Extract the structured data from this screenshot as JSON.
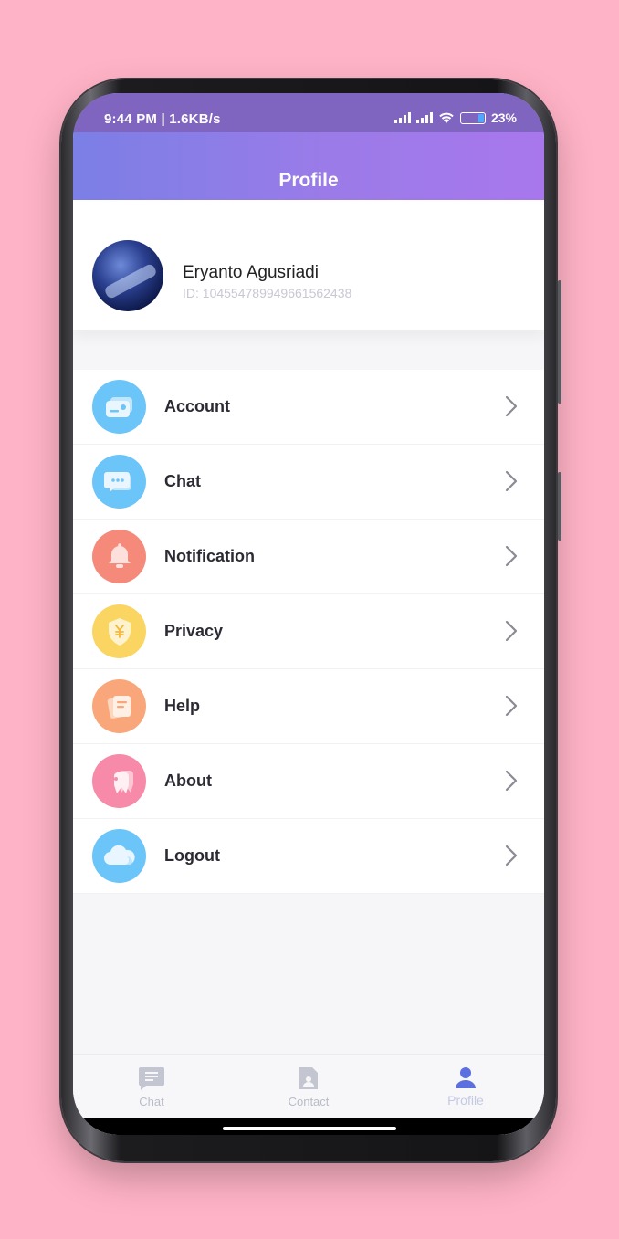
{
  "status_bar": {
    "time_and_info": "9:44 PM | 1.6KB/s",
    "battery": "23%"
  },
  "header": {
    "title": "Profile"
  },
  "profile": {
    "name": "Eryanto Agusriadi",
    "id": "ID: 104554789949661562438"
  },
  "menu": {
    "items": [
      {
        "label": "Account",
        "icon": "account-card-icon",
        "color": "#6cc5f9"
      },
      {
        "label": "Chat",
        "icon": "chat-bubble-icon",
        "color": "#6cc5f9"
      },
      {
        "label": "Notification",
        "icon": "bell-icon",
        "color": "#f58a7a"
      },
      {
        "label": "Privacy",
        "icon": "shield-yen-icon",
        "color": "#fbd561"
      },
      {
        "label": "Help",
        "icon": "document-icon",
        "color": "#f9a77a"
      },
      {
        "label": "About",
        "icon": "tooth-info-icon",
        "color": "#f78aa8"
      },
      {
        "label": "Logout",
        "icon": "cloud-icon",
        "color": "#6cc5f9"
      }
    ]
  },
  "bottom_nav": {
    "items": [
      {
        "label": "Chat",
        "icon": "chat-icon"
      },
      {
        "label": "Contact",
        "icon": "contact-icon"
      },
      {
        "label": "Profile",
        "icon": "profile-icon",
        "active": true
      }
    ]
  },
  "colors": {
    "background": "#ffb3c6",
    "header_gradient_start": "#7b7fe6",
    "header_gradient_end": "#a877ec",
    "active_nav": "#5b6fe0"
  }
}
